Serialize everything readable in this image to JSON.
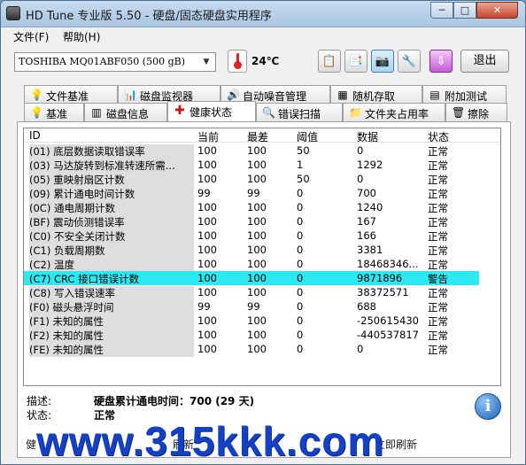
{
  "window": {
    "title": "HD Tune 专业版 5.50 - 硬盘/固态硬盘实用程序"
  },
  "window_buttons": {
    "minimize": "─",
    "maximize": "□",
    "close": "✕"
  },
  "menu": {
    "file": "文件(F)",
    "help": "帮助(H)"
  },
  "toolbar": {
    "drive": "TOSHIBA MQ01ABF050 (500 gB)",
    "temperature": "24℃",
    "exit_label": "退出"
  },
  "tabs_top": [
    {
      "label": "文件基准",
      "icon": "file-benchmark-icon"
    },
    {
      "label": "磁盘监视器",
      "icon": "disk-monitor-icon"
    },
    {
      "label": "自动噪音管理",
      "icon": "speaker-icon"
    },
    {
      "label": "随机存取",
      "icon": "random-access-icon"
    },
    {
      "label": "附加测试",
      "icon": "extra-tests-icon"
    }
  ],
  "tabs_bottom": [
    {
      "label": "基准",
      "icon": "benchmark-icon"
    },
    {
      "label": "磁盘信息",
      "icon": "disk-info-icon"
    },
    {
      "label": "健康状态",
      "icon": "health-cross-icon",
      "active": true
    },
    {
      "label": "错误扫描",
      "icon": "error-scan-icon"
    },
    {
      "label": "文件夹占用率",
      "icon": "folder-icon"
    },
    {
      "label": "擦除",
      "icon": "erase-bin-icon"
    }
  ],
  "table": {
    "headers": {
      "id": "ID",
      "current": "当前",
      "worst": "最差",
      "threshold": "阈值",
      "data": "数据",
      "status": "状态"
    },
    "rows": [
      {
        "id": "(01) 底层数据读取错误率",
        "current": "100",
        "worst": "100",
        "threshold": "50",
        "data": "0",
        "status": "正常"
      },
      {
        "id": "(03) 马达旋转到标准转速所需...",
        "current": "100",
        "worst": "100",
        "threshold": "1",
        "data": "1292",
        "status": "正常"
      },
      {
        "id": "(05) 重映射扇区计数",
        "current": "100",
        "worst": "100",
        "threshold": "50",
        "data": "0",
        "status": "正常"
      },
      {
        "id": "(09) 累计通电时间计数",
        "current": "99",
        "worst": "99",
        "threshold": "0",
        "data": "700",
        "status": "正常"
      },
      {
        "id": "(0C) 通电周期计数",
        "current": "100",
        "worst": "100",
        "threshold": "0",
        "data": "1240",
        "status": "正常"
      },
      {
        "id": "(BF) 震动侦测错误率",
        "current": "100",
        "worst": "100",
        "threshold": "0",
        "data": "167",
        "status": "正常"
      },
      {
        "id": "(C0) 不安全关闭计数",
        "current": "100",
        "worst": "100",
        "threshold": "0",
        "data": "166",
        "status": "正常"
      },
      {
        "id": "(C1) 负载周期数",
        "current": "100",
        "worst": "100",
        "threshold": "0",
        "data": "3381",
        "status": "正常"
      },
      {
        "id": "(C2) 温度",
        "current": "100",
        "worst": "100",
        "threshold": "0",
        "data": "18468346...",
        "status": "正常"
      },
      {
        "id": "(C7) CRC 接口错误计数",
        "current": "100",
        "worst": "100",
        "threshold": "0",
        "data": "9871896",
        "status": "警告",
        "highlight": true
      },
      {
        "id": "(C8) 写入错误速率",
        "current": "100",
        "worst": "100",
        "threshold": "0",
        "data": "38372571",
        "status": "正常"
      },
      {
        "id": "(F0) 磁头悬浮时间",
        "current": "99",
        "worst": "99",
        "threshold": "0",
        "data": "688",
        "status": "正常"
      },
      {
        "id": "(F1) 未知的属性",
        "current": "100",
        "worst": "100",
        "threshold": "0",
        "data": "-250615430",
        "status": "正常"
      },
      {
        "id": "(F2) 未知的属性",
        "current": "100",
        "worst": "100",
        "threshold": "0",
        "data": "-440537817",
        "status": "正常"
      },
      {
        "id": "(FE) 未知的属性",
        "current": "100",
        "worst": "100",
        "threshold": "0",
        "data": "0",
        "status": "正常"
      }
    ]
  },
  "description": {
    "desc_label": "描述:",
    "desc_value": "硬盘累计通电时间：700 (29 天)",
    "status_label": "状态:",
    "status_value": "正常"
  },
  "bottom": {
    "left_text": "健",
    "mid_text": "刷新",
    "right_text": "立即刷新"
  },
  "watermark": "www.315kkk.com",
  "colors": {
    "highlight_row": "#2ee8ef",
    "watermark": "#1440c6"
  }
}
